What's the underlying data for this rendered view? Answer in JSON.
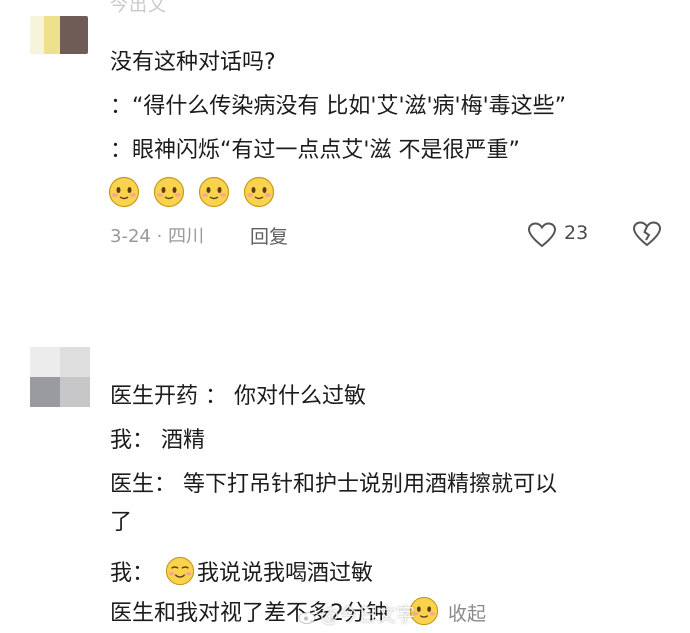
{
  "comment1": {
    "username": "今出文",
    "lines": [
      "没有这种对话吗?",
      "：“得什么传染病没有 比如'艾'滋'病'梅'毒这些”",
      "：眼神闪烁“有过一点点艾'滋 不是很严重”"
    ],
    "emojis": [
      "smile-icon",
      "smile-icon",
      "smile-icon",
      "smile-icon"
    ],
    "meta": "3-24 · 四川",
    "reply_label": "回复",
    "like_count": "23"
  },
  "comment2": {
    "lines": [
      "医生开药 ： 你对什么过敏",
      "我： 酒精",
      "医生： 等下打吊针和护士说别用酒精擦就可以",
      "了"
    ],
    "line5_prefix": "我：",
    "line5_text": "我说说我喝酒过敏",
    "line6_text": "医生和我对视了差不多2分钟",
    "collapse_label": "收起"
  },
  "watermark": {
    "text": "@今日文字"
  },
  "colors": {
    "text": "#1c1c1c",
    "meta": "#9a9a9a",
    "emoji_face": "#f9d24e",
    "emoji_outline": "#c99a1a"
  }
}
